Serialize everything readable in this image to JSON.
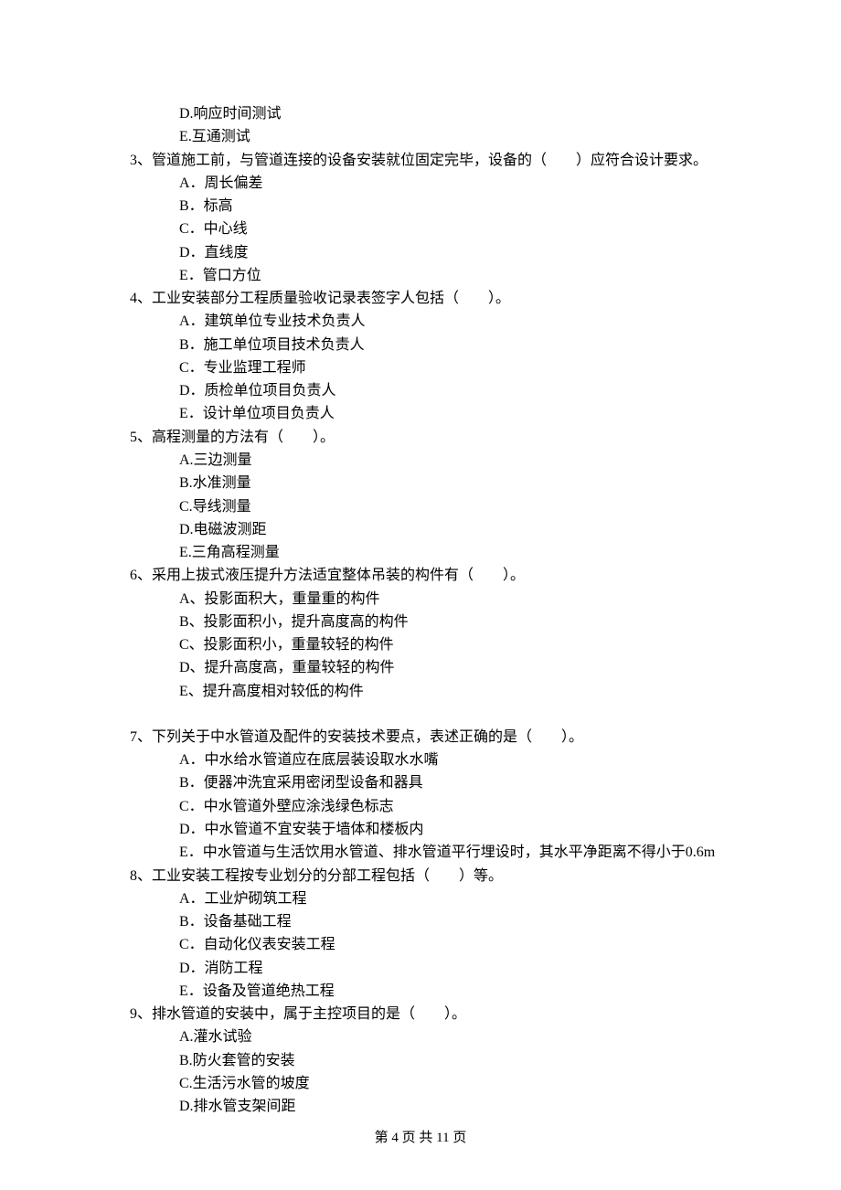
{
  "prev_tail": {
    "options": [
      "D.响应时间测试",
      "E.互通测试"
    ]
  },
  "questions": [
    {
      "number": "3、",
      "stem": "管道施工前，与管道连接的设备安装就位固定完毕，设备的（　　）应符合设计要求。",
      "options": [
        "A．周长偏差",
        "B．标高",
        "C．中心线",
        "D．直线度",
        "E．管口方位"
      ]
    },
    {
      "number": "4、",
      "stem": "工业安装部分工程质量验收记录表签字人包括（　　）。",
      "options": [
        "A．建筑单位专业技术负责人",
        "B．施工单位项目技术负责人",
        "C．专业监理工程师",
        "D．质检单位项目负责人",
        "E．设计单位项目负责人"
      ]
    },
    {
      "number": "5、",
      "stem": "高程测量的方法有（　　）。",
      "options": [
        "A.三边测量",
        "B.水准测量",
        "C.导线测量",
        "D.电磁波测距",
        "E.三角高程测量"
      ]
    },
    {
      "number": "6、",
      "stem": "采用上拔式液压提升方法适宜整体吊装的构件有（　　）。",
      "options": [
        "A、投影面积大，重量重的构件",
        "B、投影面积小，提升高度高的构件",
        "C、投影面积小，重量较轻的构件",
        "D、提升高度高，重量较轻的构件",
        "E、提升高度相对较低的构件"
      ],
      "trailing_blank": true
    },
    {
      "number": "7、",
      "stem": "下列关于中水管道及配件的安装技术要点，表述正确的是（　　）。",
      "options": [
        "A．中水给水管道应在底层装设取水水嘴",
        "B．便器冲洗宜采用密闭型设备和器具",
        "C．中水管道外壁应涂浅绿色标志",
        "D．中水管道不宜安装于墙体和楼板内",
        "E．中水管道与生活饮用水管道、排水管道平行埋设时，其水平净距离不得小于0.6m"
      ]
    },
    {
      "number": "8、",
      "stem": "工业安装工程按专业划分的分部工程包括（　　）等。",
      "options": [
        "A．工业炉砌筑工程",
        "B．设备基础工程",
        "C．自动化仪表安装工程",
        "D．消防工程",
        "E．设备及管道绝热工程"
      ]
    },
    {
      "number": "9、",
      "stem": "排水管道的安装中，属于主控项目的是（　　）。",
      "options": [
        "A.灌水试验",
        "B.防火套管的安装",
        "C.生活污水管的坡度",
        "D.排水管支架间距"
      ]
    }
  ],
  "footer": "第 4 页 共 11 页"
}
